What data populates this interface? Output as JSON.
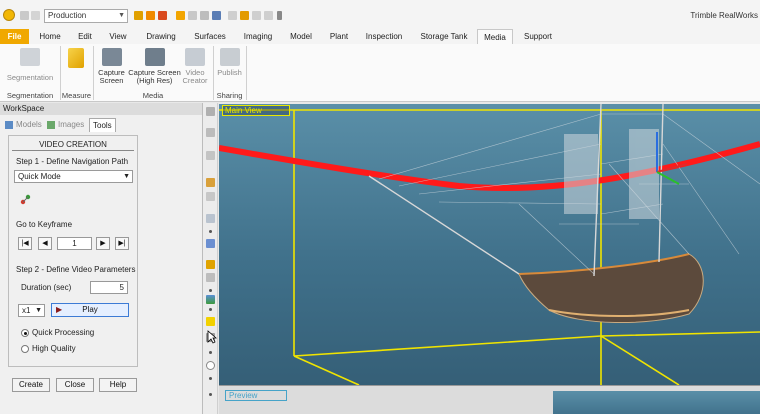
{
  "quick_access": {
    "combo_value": "Production",
    "app_title": "Trimble RealWorks"
  },
  "tabs": [
    "File",
    "Home",
    "Edit",
    "View",
    "Drawing",
    "Surfaces",
    "Imaging",
    "Model",
    "Plant",
    "Inspection",
    "Storage Tank",
    "Media",
    "Support"
  ],
  "active_tab": "Media",
  "ribbon": {
    "segmentation": {
      "label": "Segmentation",
      "group": "Segmentation"
    },
    "measure": {
      "group": "Measure"
    },
    "capture_screen": {
      "line1": "Capture",
      "line2": "Screen"
    },
    "capture_high_res": {
      "line1": "Capture Screen",
      "line2": "(High Res)"
    },
    "video_creator": {
      "line1": "Video",
      "line2": "Creator"
    },
    "media_group": "Media",
    "publish": {
      "label": "Publish"
    },
    "sharing_group": "Sharing"
  },
  "workspace": {
    "title": "WorkSpace",
    "tabs": {
      "models": "Models",
      "images": "Images",
      "tools": "Tools"
    },
    "panel": {
      "header": "VIDEO CREATION",
      "step1": "Step 1 - Define Navigation Path",
      "mode_value": "Quick Mode",
      "goto_keyframe": "Go to Keyframe",
      "keyframe_value": "1",
      "step2": "Step 2 - Define Video Parameters",
      "duration_label": "Duration (sec)",
      "duration_value": "5",
      "speed_value": "x1",
      "play_label": "Play",
      "quick_processing": "Quick Processing",
      "high_quality": "High Quality",
      "processing_selected": "Quick Processing"
    },
    "buttons": {
      "create": "Create",
      "close": "Close",
      "help": "Help"
    }
  },
  "viewport": {
    "label": "Main View",
    "preview_label": "Preview"
  }
}
